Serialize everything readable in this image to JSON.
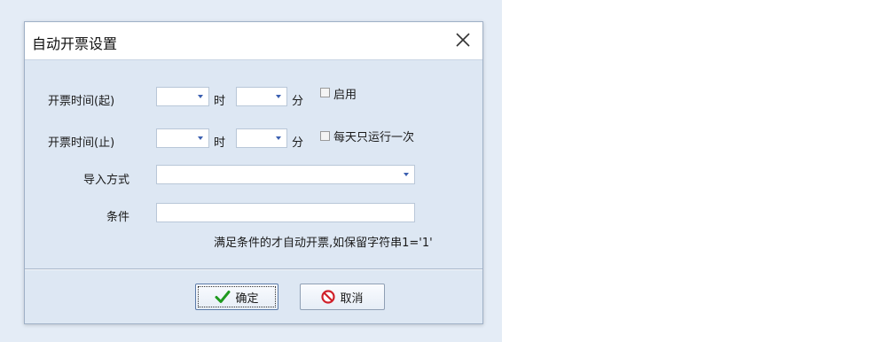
{
  "dialog": {
    "title": "自动开票设置",
    "close_glyph": "✕"
  },
  "form": {
    "start_label": "开票时间(起)",
    "end_label": "开票时间(止)",
    "hour_unit": "时",
    "minute_unit": "分",
    "start_hour": "",
    "start_minute": "",
    "end_hour": "",
    "end_minute": "",
    "enable_label": "启用",
    "enable_checked": false,
    "once_daily_label": "每天只运行一次",
    "once_daily_checked": false,
    "import_label": "导入方式",
    "import_value": "",
    "condition_label": "条件",
    "condition_value": "",
    "hint": "满足条件的才自动开票,如保留字符串1='1'"
  },
  "buttons": {
    "ok_label": "确定",
    "cancel_label": "取消"
  },
  "icons": {
    "ok": "check-icon",
    "cancel": "no-entry-icon",
    "close": "close-icon"
  },
  "colors": {
    "accent": "#3b5fb0",
    "ok_icon": "#1f9a1f",
    "cancel_icon": "#d0202a"
  }
}
